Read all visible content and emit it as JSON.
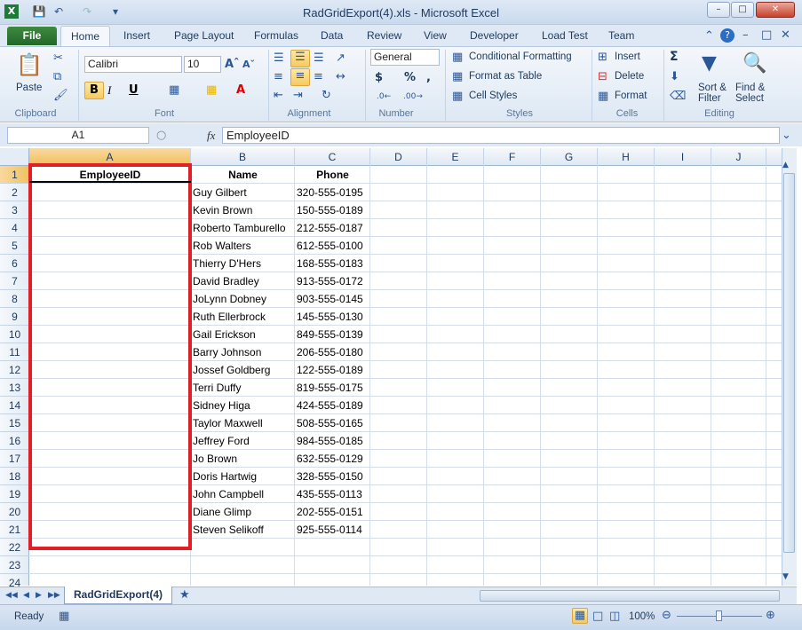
{
  "window": {
    "title": "RadGridExport(4).xls  -  Microsoft Excel",
    "minimize": "–",
    "restore": "□",
    "close": "✕"
  },
  "tabs": {
    "file": "File",
    "items": [
      "Home",
      "Insert",
      "Page Layout",
      "Formulas",
      "Data",
      "Review",
      "View",
      "Developer",
      "Load Test",
      "Team"
    ]
  },
  "ribbon": {
    "clipboard": {
      "paste": "Paste",
      "label": "Clipboard"
    },
    "font": {
      "name": "Calibri",
      "size": "10",
      "bold": "B",
      "italic": "I",
      "underline": "U",
      "label": "Font"
    },
    "alignment": {
      "label": "Alignment"
    },
    "number": {
      "format": "General",
      "currency": "$",
      "percent": "%",
      "comma": ",",
      "label": "Number"
    },
    "styles": {
      "conditional": "Conditional Formatting",
      "table": "Format as Table",
      "cell": "Cell Styles",
      "label": "Styles"
    },
    "cells": {
      "insert": "Insert",
      "delete": "Delete",
      "format": "Format",
      "label": "Cells"
    },
    "editing": {
      "sum": "Σ",
      "sort": "Sort &",
      "sort2": "Filter",
      "find": "Find &",
      "find2": "Select",
      "label": "Editing"
    }
  },
  "formula_bar": {
    "name_box": "A1",
    "fx": "fx",
    "value": "EmployeeID"
  },
  "grid": {
    "columns": [
      "A",
      "B",
      "C",
      "D",
      "E",
      "F",
      "G",
      "H",
      "I",
      "J"
    ],
    "rows": [
      "1",
      "2",
      "3",
      "4",
      "5",
      "6",
      "7",
      "8",
      "9",
      "10",
      "11",
      "12",
      "13",
      "14",
      "15",
      "16",
      "17",
      "18",
      "19",
      "20",
      "21",
      "22",
      "23",
      "24"
    ],
    "headers": [
      "EmployeeID",
      "Name",
      "Phone"
    ],
    "data": [
      [
        "Guy Gilbert",
        "320-555-0195"
      ],
      [
        "Kevin Brown",
        "150-555-0189"
      ],
      [
        "Roberto Tamburello",
        "212-555-0187"
      ],
      [
        "Rob Walters",
        "612-555-0100"
      ],
      [
        "Thierry D'Hers",
        "168-555-0183"
      ],
      [
        "David Bradley",
        "913-555-0172"
      ],
      [
        "JoLynn Dobney",
        "903-555-0145"
      ],
      [
        "Ruth Ellerbrock",
        "145-555-0130"
      ],
      [
        "Gail Erickson",
        "849-555-0139"
      ],
      [
        "Barry Johnson",
        "206-555-0180"
      ],
      [
        "Jossef Goldberg",
        "122-555-0189"
      ],
      [
        "Terri Duffy",
        "819-555-0175"
      ],
      [
        "Sidney Higa",
        "424-555-0189"
      ],
      [
        "Taylor Maxwell",
        "508-555-0165"
      ],
      [
        "Jeffrey Ford",
        "984-555-0185"
      ],
      [
        "Jo Brown",
        "632-555-0129"
      ],
      [
        "Doris Hartwig",
        "328-555-0150"
      ],
      [
        "John Campbell",
        "435-555-0113"
      ],
      [
        "Diane Glimp",
        "202-555-0151"
      ],
      [
        "Steven Selikoff",
        "925-555-0114"
      ]
    ]
  },
  "sheet": {
    "tab": "RadGridExport(4)"
  },
  "status": {
    "ready": "Ready",
    "zoom": "100%"
  }
}
